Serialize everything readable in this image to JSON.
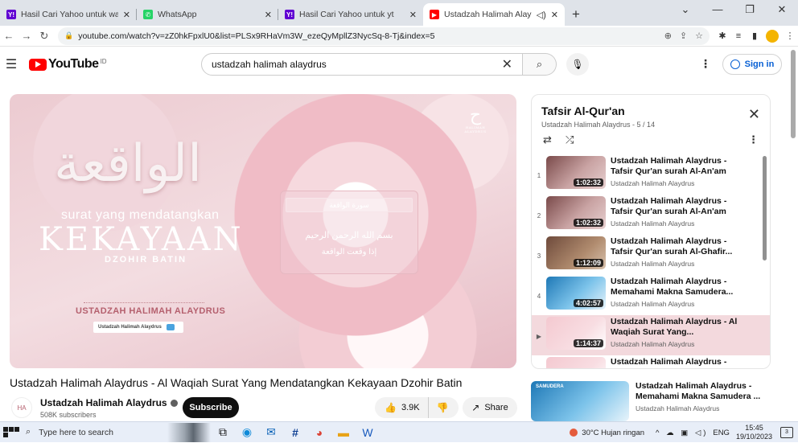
{
  "browser": {
    "tabs": [
      {
        "title": "Hasil Cari Yahoo untuk wa web",
        "favicon": "yahoo-icon",
        "color": "#6001d2",
        "glyph": "Y!"
      },
      {
        "title": "WhatsApp",
        "favicon": "whatsapp-icon",
        "color": "#25d366",
        "glyph": "✆"
      },
      {
        "title": "Hasil Cari Yahoo untuk yt",
        "favicon": "yahoo-icon",
        "color": "#6001d2",
        "glyph": "Y!"
      },
      {
        "title": "Ustadzah Halimah Alaydru",
        "favicon": "youtube-icon",
        "color": "#ff0000",
        "glyph": "▶"
      }
    ],
    "url": "youtube.com/watch?v=zZ0hkFpxlU0&list=PLSx9RHaVm3W_ezeQyMpllZ3NycSq-8-Tj&index=5"
  },
  "header": {
    "logo_text": "YouTube",
    "logo_sup": "ID",
    "search_value": "ustadzah halimah alaydrus",
    "signin_label": "Sign in"
  },
  "video": {
    "overlay": {
      "arabic_title": "الواقعة",
      "subtitle": "surat yang mendatangkan",
      "headline": "KEKAYAAN",
      "tagline": "DZOHIR BATIN",
      "presenter": "USTADZAH HALIMAH ALAYDRUS",
      "badge": "Ustadzah Halimah Alaydrus",
      "panel_band": "سورة الواقعة",
      "panel_line1": "بسم الله الرحمن الرحيم",
      "panel_line2": "إذا وقعت الواقعة",
      "logo_caption": "HALIMAH ALAYDRUS"
    },
    "title": "Ustadzah Halimah Alaydrus - Al Waqiah Surat Yang Mendatangkan Kekayaan Dzohir Batin",
    "channel": "Ustadzah Halimah Alaydrus",
    "subscribers": "508K subscribers",
    "subscribe_label": "Subscribe",
    "likes": "3.9K",
    "share_label": "Share"
  },
  "playlist": {
    "title": "Tafsir Al-Qur'an",
    "subtitle": "Ustadzah Halimah Alaydrus - 5 / 14",
    "items": [
      {
        "index": "1",
        "title": "Ustadzah Halimah Alaydrus - Tafsir Qur'an surah Al-An'am",
        "channel": "Ustadzah Halimah Alaydrus",
        "duration": "1:02:32",
        "thumb": "th-red"
      },
      {
        "index": "2",
        "title": "Ustadzah Halimah Alaydrus - Tafsir Qur'an surah Al-An'am",
        "channel": "Ustadzah Halimah Alaydrus",
        "duration": "1:02:32",
        "thumb": "th-red"
      },
      {
        "index": "3",
        "title": "Ustadzah Halimah Alaydrus - Tafsir Qur'an surah Al-Ghafir...",
        "channel": "Ustadzah Halimah Alaydrus",
        "duration": "1:12:09",
        "thumb": "th-brown"
      },
      {
        "index": "4",
        "title": "Ustadzah Halimah Alaydrus - Memahami Makna Samudera...",
        "channel": "Ustadzah Halimah Alaydrus",
        "duration": "4:02:57",
        "thumb": "th-blue"
      },
      {
        "index": "▶",
        "title": "Ustadzah Halimah Alaydrus - Al Waqiah Surat Yang...",
        "channel": "Ustadzah Halimah Alaydrus",
        "duration": "1:14:37",
        "thumb": "th-pink",
        "active": true
      },
      {
        "index": "",
        "title": "Ustadzah Halimah Alaydrus -",
        "channel": "",
        "duration": "",
        "thumb": "th-pink"
      }
    ]
  },
  "recommendation": {
    "thumb_label": "SAMUDERA",
    "title": "Ustadzah Halimah Alaydrus - Memahami Makna Samudera ...",
    "channel": "Ustadzah Halimah Alaydrus"
  },
  "taskbar": {
    "search_placeholder": "Type here to search",
    "weather": "30°C  Hujan ringan",
    "lang": "ENG",
    "time": "15:45",
    "date": "19/10/2023",
    "notifications": "3"
  }
}
